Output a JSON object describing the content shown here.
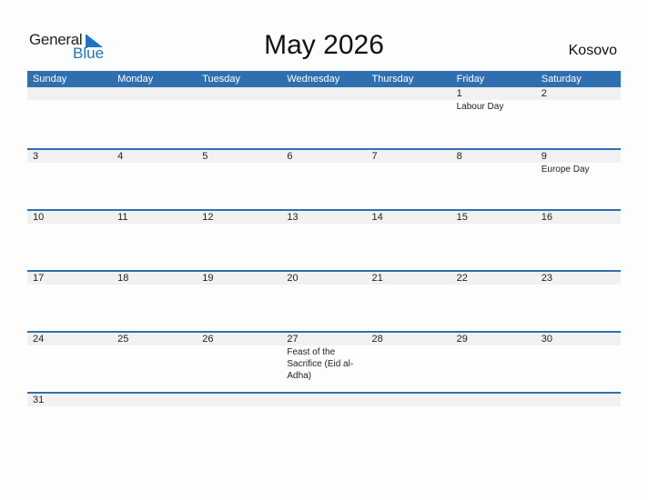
{
  "logo": {
    "word1": "General",
    "word2": "Blue"
  },
  "title": "May 2026",
  "country": "Kosovo",
  "colors": {
    "header": "#2f6fb0",
    "brand": "#1f73c0",
    "strip": "#f1f1f1"
  },
  "weekdays": [
    "Sunday",
    "Monday",
    "Tuesday",
    "Wednesday",
    "Thursday",
    "Friday",
    "Saturday"
  ],
  "weeks": [
    [
      {
        "d": "",
        "e": ""
      },
      {
        "d": "",
        "e": ""
      },
      {
        "d": "",
        "e": ""
      },
      {
        "d": "",
        "e": ""
      },
      {
        "d": "",
        "e": ""
      },
      {
        "d": "1",
        "e": "Labour Day"
      },
      {
        "d": "2",
        "e": ""
      }
    ],
    [
      {
        "d": "3",
        "e": ""
      },
      {
        "d": "4",
        "e": ""
      },
      {
        "d": "5",
        "e": ""
      },
      {
        "d": "6",
        "e": ""
      },
      {
        "d": "7",
        "e": ""
      },
      {
        "d": "8",
        "e": ""
      },
      {
        "d": "9",
        "e": "Europe Day"
      }
    ],
    [
      {
        "d": "10",
        "e": ""
      },
      {
        "d": "11",
        "e": ""
      },
      {
        "d": "12",
        "e": ""
      },
      {
        "d": "13",
        "e": ""
      },
      {
        "d": "14",
        "e": ""
      },
      {
        "d": "15",
        "e": ""
      },
      {
        "d": "16",
        "e": ""
      }
    ],
    [
      {
        "d": "17",
        "e": ""
      },
      {
        "d": "18",
        "e": ""
      },
      {
        "d": "19",
        "e": ""
      },
      {
        "d": "20",
        "e": ""
      },
      {
        "d": "21",
        "e": ""
      },
      {
        "d": "22",
        "e": ""
      },
      {
        "d": "23",
        "e": ""
      }
    ],
    [
      {
        "d": "24",
        "e": ""
      },
      {
        "d": "25",
        "e": ""
      },
      {
        "d": "26",
        "e": ""
      },
      {
        "d": "27",
        "e": "Feast of the Sacrifice (Eid al-Adha)"
      },
      {
        "d": "28",
        "e": ""
      },
      {
        "d": "29",
        "e": ""
      },
      {
        "d": "30",
        "e": ""
      }
    ],
    [
      {
        "d": "31",
        "e": ""
      },
      {
        "d": "",
        "e": ""
      },
      {
        "d": "",
        "e": ""
      },
      {
        "d": "",
        "e": ""
      },
      {
        "d": "",
        "e": ""
      },
      {
        "d": "",
        "e": ""
      },
      {
        "d": "",
        "e": ""
      }
    ]
  ]
}
